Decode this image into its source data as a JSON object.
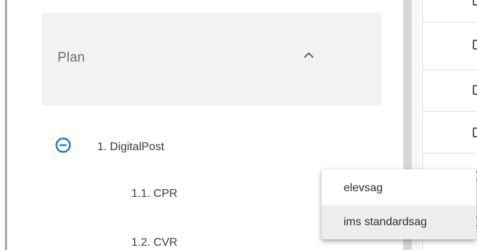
{
  "accordion": {
    "title": "Plan"
  },
  "tree": {
    "nodes": [
      {
        "label": "1. DigitalPost"
      },
      {
        "label": "1.1. CPR"
      },
      {
        "label": "1.2. CVR"
      }
    ]
  },
  "dropdown": {
    "items": [
      {
        "label": "elevsag",
        "highlighted": false
      },
      {
        "label": "ims standardsag",
        "highlighted": true
      }
    ]
  },
  "colors": {
    "accent": "#1976d2",
    "menu_highlight": "#ededed",
    "header_background": "#f2f2f2"
  },
  "icons": {
    "accordion_toggle": "chevron-up-icon",
    "tree_toggle": "minus-circle-icon"
  }
}
